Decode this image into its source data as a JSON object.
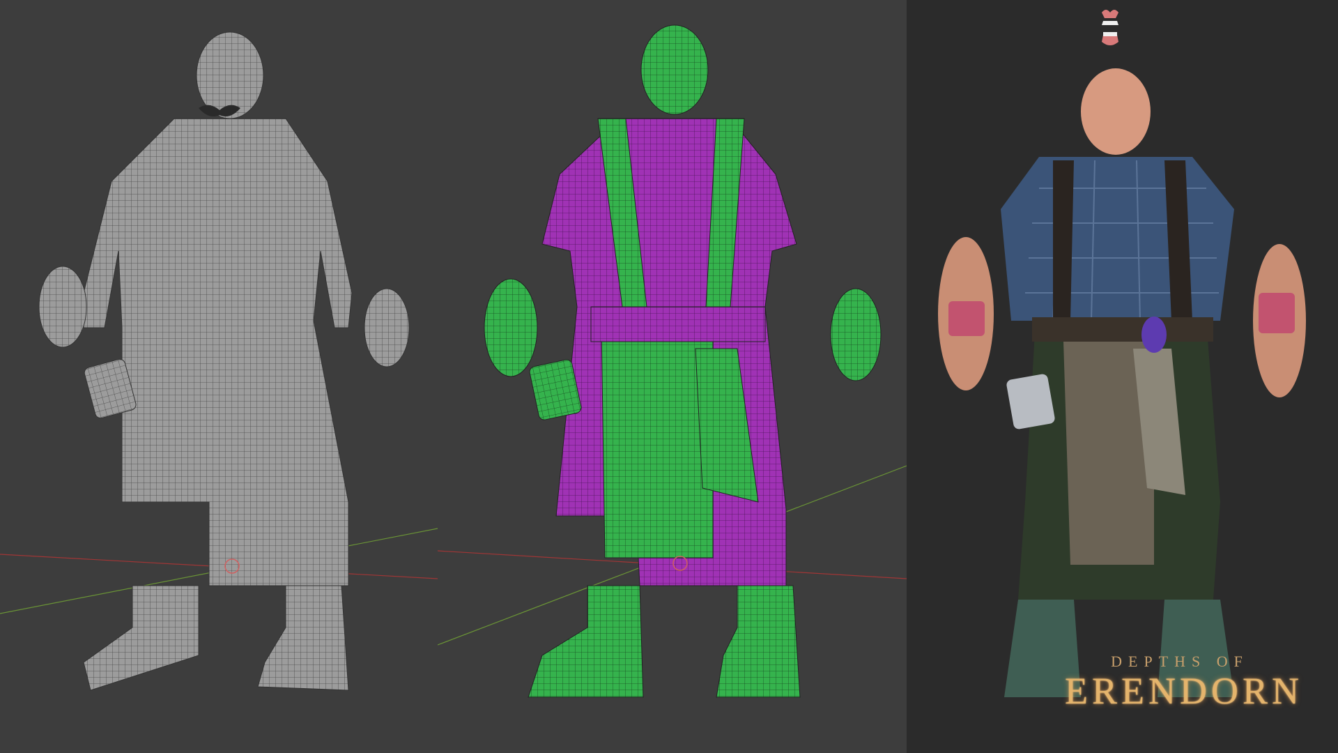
{
  "app": {
    "type": "3d-character-showcase"
  },
  "panels": {
    "wireframe": {
      "mode": "solid-wireframe",
      "mesh_color": "#9a9a9a"
    },
    "color_id": {
      "mode": "material-id",
      "body_color": "#2fb34a",
      "cloth_color": "#9b2fae"
    },
    "render": {
      "mode": "final-render",
      "background": "#2b2b2b"
    }
  },
  "logo": {
    "line1": "DEPTHS OF",
    "line2": "ERENDORN"
  },
  "colors": {
    "viewport_bg": "#3d3d3d",
    "x_axis": "#b03a3a",
    "y_axis": "#6e9a3a",
    "logo_gold": "#e4b46c"
  }
}
